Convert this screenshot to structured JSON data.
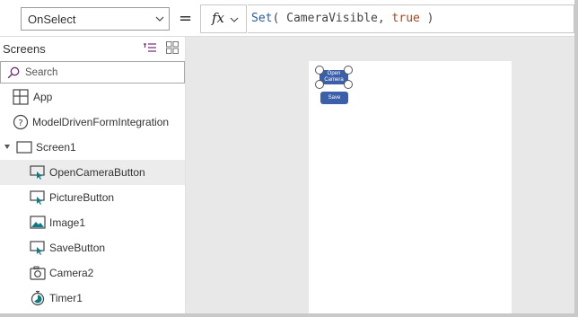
{
  "formula_bar": {
    "property": "OnSelect",
    "equals": "=",
    "fx_label": "fx",
    "formula_tokens": {
      "fn": "Set",
      "open": "( ",
      "arg": "CameraVisible",
      "sep": ", ",
      "value": "true",
      "close": " )"
    }
  },
  "panel": {
    "title": "Screens",
    "search_placeholder": "Search",
    "items": [
      {
        "label": "App",
        "icon": "app-icon"
      },
      {
        "label": "ModelDrivenFormIntegration",
        "icon": "help-circle-icon"
      },
      {
        "label": "Screen1",
        "icon": "screen-icon"
      },
      {
        "label": "OpenCameraButton",
        "icon": "button-icon"
      },
      {
        "label": "PictureButton",
        "icon": "button-icon"
      },
      {
        "label": "Image1",
        "icon": "image-icon"
      },
      {
        "label": "SaveButton",
        "icon": "button-icon"
      },
      {
        "label": "Camera2",
        "icon": "camera-icon"
      },
      {
        "label": "Timer1",
        "icon": "timer-icon"
      }
    ],
    "selected_item": "OpenCameraButton"
  },
  "canvas": {
    "open_button_label_line1": "Open",
    "open_button_label_line2": "Camera",
    "save_button_label": "Save"
  },
  "colors": {
    "accent_button": "#3b5fa8",
    "selection_bg": "#ececec",
    "icon_teal": "#0b7d86",
    "panel_icon_purple": "#742774"
  }
}
